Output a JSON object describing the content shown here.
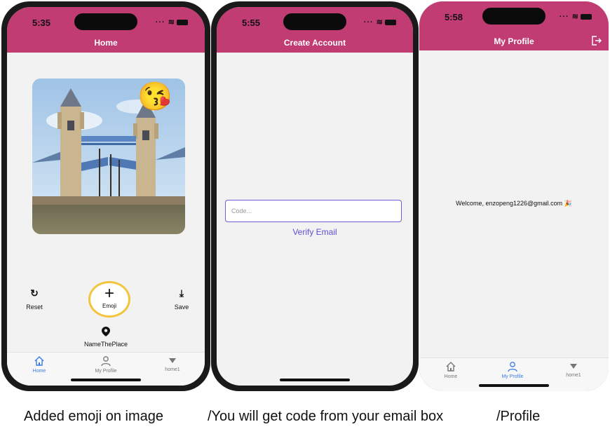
{
  "colors": {
    "header": "#c23c74",
    "tab_active": "#3b7be8",
    "accent_link": "#5b4fd6",
    "emoji_ring": "#f2c53d"
  },
  "phones": [
    {
      "time": "5:35",
      "title": "Home",
      "sticker_emoji": "😘",
      "tools": {
        "reset": "Reset",
        "emoji": "Emoji",
        "save": "Save"
      },
      "place_label": "NameThePlace",
      "tabs": [
        {
          "label": "Home",
          "icon": "home-icon",
          "active": true
        },
        {
          "label": "My Profile",
          "icon": "person-icon",
          "active": false
        },
        {
          "label": "home1",
          "icon": "triangle-icon",
          "active": false
        }
      ]
    },
    {
      "time": "5:55",
      "title": "Create Account",
      "code_placeholder": "Code...",
      "verify_label": "Verify Email"
    },
    {
      "time": "5:58",
      "title": "My Profile",
      "welcome_text": "Welcome, enzopeng1226@gmail.com 🎉",
      "tabs": [
        {
          "label": "Home",
          "icon": "home-icon",
          "active": false
        },
        {
          "label": "My Profile",
          "icon": "person-icon",
          "active": true
        },
        {
          "label": "home1",
          "icon": "triangle-icon",
          "active": false
        }
      ]
    }
  ],
  "captions": [
    "Added emoji on image",
    "/You will get code from your email box",
    "/Profile"
  ]
}
